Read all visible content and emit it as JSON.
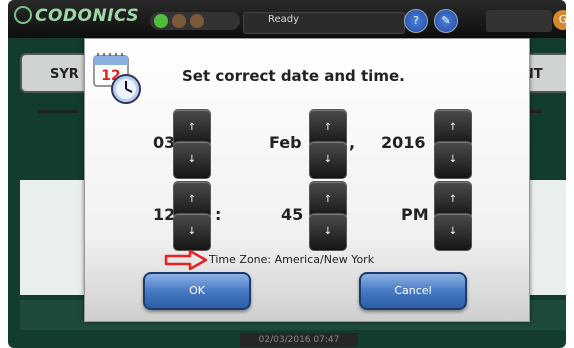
{
  "app": {
    "brand": "CODONICS",
    "status": "Ready",
    "toolbar_buttons": [
      {
        "icon": "help-icon",
        "glyph": "?"
      },
      {
        "icon": "pencil-icon",
        "glyph": "✎"
      }
    ],
    "corner_button": {
      "icon": "g-icon",
      "glyph": "G"
    },
    "tabs": {
      "left": "SYR",
      "right": "ENT"
    },
    "clock": "02/03/2016 07:47",
    "led_colors": [
      "#4fbf3a",
      "#7a5a3a",
      "#7a5a3a"
    ]
  },
  "dialog": {
    "title": "Set correct date and time.",
    "icon": "calendar-clock-icon",
    "calendar_number": "12",
    "date": {
      "month_value": "03",
      "day_value": "Feb",
      "date_separator": ",",
      "year_value": "2016"
    },
    "time": {
      "hour_value": "12",
      "time_separator": ":",
      "minute_value": "45",
      "ampm_value": "PM"
    },
    "up_glyph": "↑",
    "down_glyph": "↓",
    "timezone": "Time Zone: America/New York",
    "ok_label": "OK",
    "cancel_label": "Cancel"
  },
  "colors": {
    "background": "#123c30",
    "dialog_bg": "#f4f4f4",
    "button_blue": "#4a7cc6",
    "spinner": "#222222",
    "arrow_annotation": "#e52323"
  }
}
